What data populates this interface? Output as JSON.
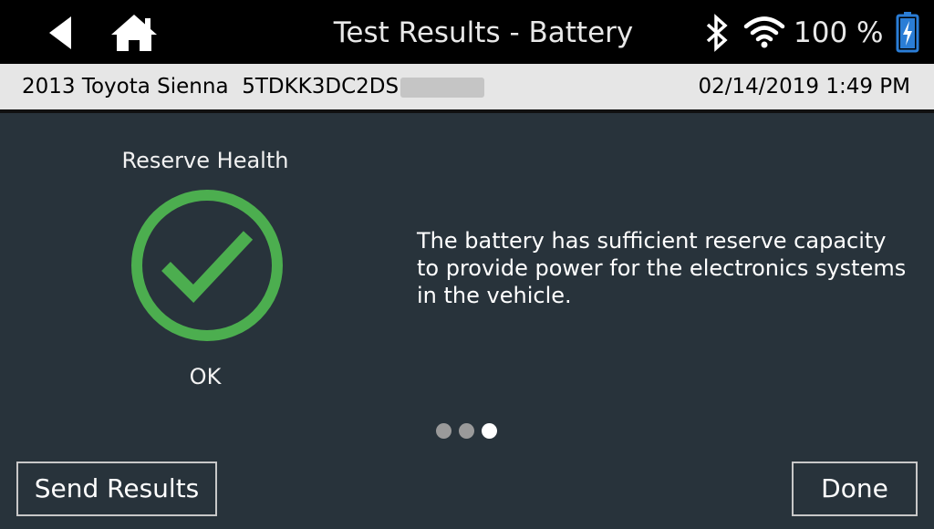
{
  "header": {
    "title": "Test Results - Battery",
    "battery_percent": "100 %",
    "icons": [
      "back-arrow-icon",
      "home-icon",
      "bluetooth-icon",
      "wifi-icon",
      "battery-charging-icon"
    ]
  },
  "info_bar": {
    "vehicle": "2013 Toyota Sienna",
    "vin": "5TDKK3DC2DS",
    "datetime": "02/14/2019 1:49 PM"
  },
  "result": {
    "heading": "Reserve Health",
    "status": "OK",
    "status_icon": "check-circle-icon",
    "message": "The battery has sufficient reserve capacity to provide power for the electronics systems in the vehicle."
  },
  "pagination": {
    "total": 3,
    "current": 3
  },
  "buttons": {
    "send": "Send Results",
    "done": "Done"
  },
  "colors": {
    "background": "#28333b",
    "topbar": "#000000",
    "info_bar": "#e6e6e6",
    "ok_green": "#4cae4f",
    "battery_blue": "#2a7dd6"
  }
}
